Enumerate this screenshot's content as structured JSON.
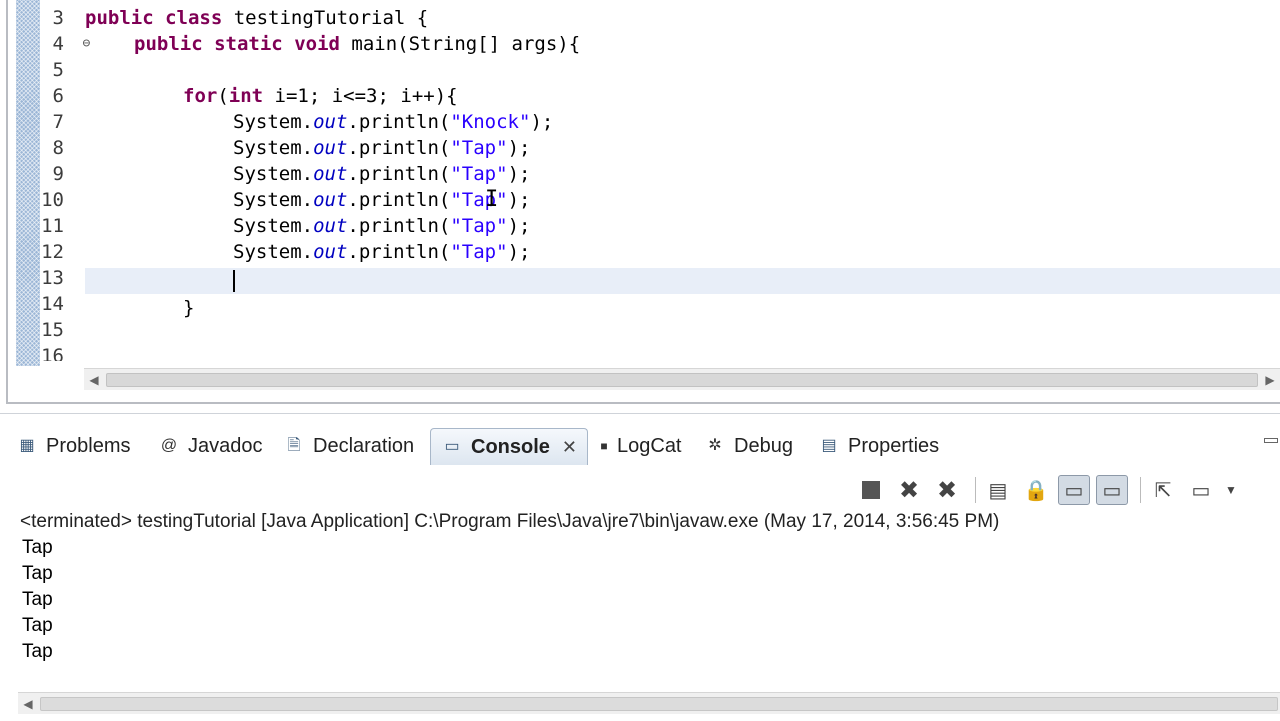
{
  "editor": {
    "line_numbers": [
      "3",
      "4",
      "5",
      "6",
      "7",
      "8",
      "9",
      "10",
      "11",
      "12",
      "13",
      "14",
      "15",
      "16"
    ],
    "fold_icon": "collapse-icon",
    "lines": {
      "l3": {
        "kw1": "public",
        "kw2": "class",
        "rest": " testingTutorial {"
      },
      "l4": {
        "kw1": "public",
        "kw2": "static",
        "kw3": "void",
        "rest": " main(String[] args){"
      },
      "l6": {
        "kw": "for",
        "open": "(",
        "kw2": "int",
        "rest": " i=1; i<=3; i++){"
      },
      "l7": {
        "pre": "System.",
        "field": "out",
        "mid": ".println(",
        "str": "\"Knock\"",
        "end": ");"
      },
      "l8": {
        "pre": "System.",
        "field": "out",
        "mid": ".println(",
        "str": "\"Tap\"",
        "end": ");"
      },
      "l9": {
        "pre": "System.",
        "field": "out",
        "mid": ".println(",
        "str": "\"Tap\"",
        "end": ");"
      },
      "l10": {
        "pre": "System.",
        "field": "out",
        "mid": ".println(",
        "str": "\"Tap\"",
        "end": ");"
      },
      "l11": {
        "pre": "System.",
        "field": "out",
        "mid": ".println(",
        "str": "\"Tap\"",
        "end": ");"
      },
      "l12": {
        "pre": "System.",
        "field": "out",
        "mid": ".println(",
        "str": "\"Tap\"",
        "end": ");"
      },
      "l14": {
        "text": "}"
      }
    }
  },
  "tabs": [
    {
      "label": "Problems",
      "icon": "problems-icon"
    },
    {
      "label": "Javadoc",
      "icon": "at-sign-icon"
    },
    {
      "label": "Declaration",
      "icon": "declaration-icon"
    },
    {
      "label": "Console",
      "icon": "console-icon",
      "active": true
    },
    {
      "label": "LogCat",
      "icon": "logcat-icon"
    },
    {
      "label": "Debug",
      "icon": "bug-icon"
    },
    {
      "label": "Properties",
      "icon": "properties-icon"
    }
  ],
  "console": {
    "header": "<terminated> testingTutorial [Java Application] C:\\Program Files\\Java\\jre7\\bin\\javaw.exe (May 17, 2014, 3:56:45 PM)",
    "output": [
      "Tap",
      "Tap",
      "Tap",
      "Tap",
      "Tap"
    ]
  },
  "colors": {
    "keyword": "#7f0055",
    "string": "#2a00ff",
    "field": "#0000c0",
    "current_line": "#e8eef8"
  }
}
